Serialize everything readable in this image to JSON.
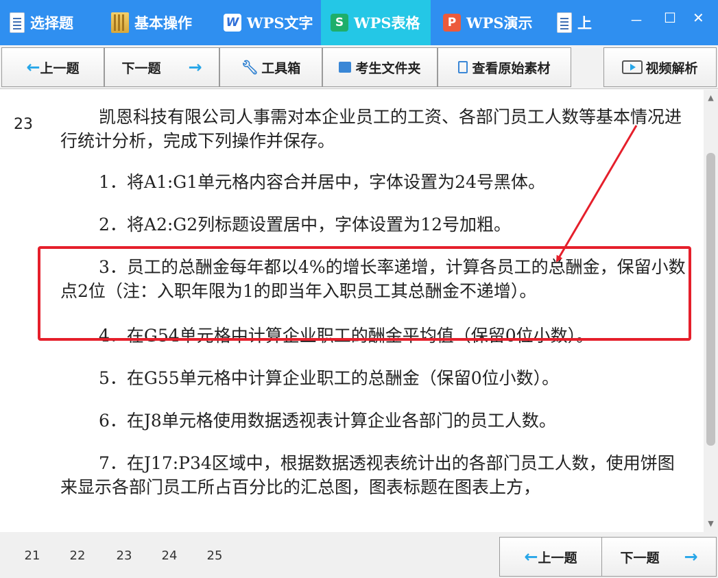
{
  "tabs": [
    {
      "label": "选择题",
      "icon": "document-icon"
    },
    {
      "label": "基本操作",
      "icon": "folder-icon"
    },
    {
      "label": "WPS文字",
      "icon": "wps-writer-icon"
    },
    {
      "label": "WPS表格",
      "icon": "wps-spreadsheet-icon",
      "active": true
    },
    {
      "label": "WPS演示",
      "icon": "wps-presentation-icon"
    },
    {
      "label": "上",
      "icon": "document-icon"
    }
  ],
  "window_controls": {
    "minimize": "－",
    "maximize": "☐",
    "close": "✕"
  },
  "toolbar": {
    "prev_label": "上一题",
    "next_label": "下一题",
    "toolbox_label": "工具箱",
    "exam_folder_label": "考生文件夹",
    "view_material_label": "查看原始素材",
    "video_label": "视频解析"
  },
  "question": {
    "number": "23",
    "intro": "凯恩科技有限公司人事需对本企业员工的工资、各部门员工人数等基本情况进行统计分析，完成下列操作并保存。",
    "items": [
      "1．将A1:G1单元格内容合并居中，字体设置为24号黑体。",
      "2．将A2:G2列标题设置居中，字体设置为12号加粗。",
      "3．员工的总酬金每年都以4%的增长率递增，计算各员工的总酬金，保留小数点2位（注：入职年限为1的即当年入职员工其总酬金不递增）。",
      "4．在G54单元格中计算企业职工的酬金平均值（保留0位小数）。",
      "5．在G55单元格中计算企业职工的总酬金（保留0位小数）。",
      "6．在J8单元格使用数据透视表计算企业各部门的员工人数。",
      "7．在J17:P34区域中，根据数据透视表统计出的各部门员工人数，使用饼图来显示各部门员工所占百分比的汇总图，图表标题在图表上方，"
    ]
  },
  "annotation_color": "#e51f2b",
  "footer": {
    "pages": [
      "21",
      "22",
      "23",
      "24",
      "25"
    ],
    "current_page": "23",
    "prev_label": "上一题",
    "next_label": "下一题"
  }
}
